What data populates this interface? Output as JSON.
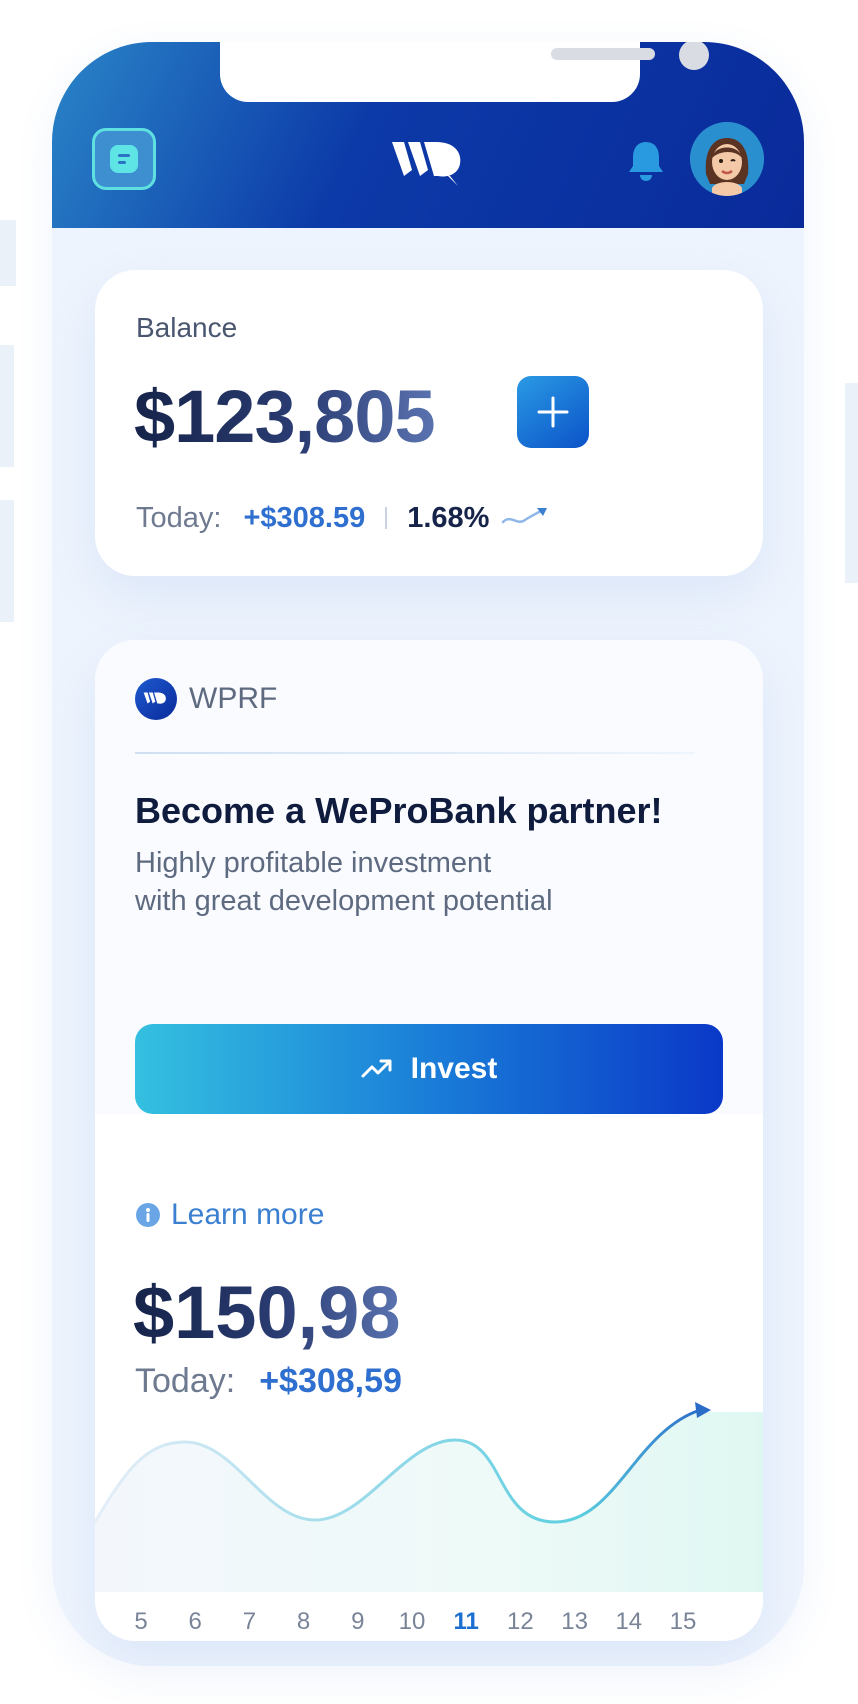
{
  "header": {
    "menu_icon": "menu-icon",
    "logo_icon": "wepro-logo-icon",
    "bell_icon": "bell-icon",
    "avatar_icon": "user-avatar"
  },
  "balance": {
    "label": "Balance",
    "amount": "$123,805",
    "today_label": "Today:",
    "today_change": "+$308.59",
    "today_percent": "1.68%"
  },
  "promo": {
    "ticker": "WPRF",
    "title": "Become a WeProBank partner!",
    "subtitle_line1": "Highly profitable investment",
    "subtitle_line2": "with great development potential",
    "button_label": "Invest"
  },
  "fund": {
    "learn_more": "Learn more",
    "amount": "$150,98",
    "today_label": "Today:",
    "today_change": "+$308,59"
  },
  "chart_data": {
    "type": "area",
    "x": [
      "5",
      "6",
      "7",
      "8",
      "9",
      "10",
      "11",
      "12",
      "13",
      "14",
      "15"
    ],
    "selected_x": "11",
    "labels": [
      "5",
      "6",
      "7",
      "8",
      "9",
      "10",
      "11",
      "12",
      "13",
      "14",
      "15"
    ]
  },
  "colors": {
    "header_dark": "#0a2a9a",
    "accent": "#2f6fcf",
    "teal": "#34c0e0"
  }
}
